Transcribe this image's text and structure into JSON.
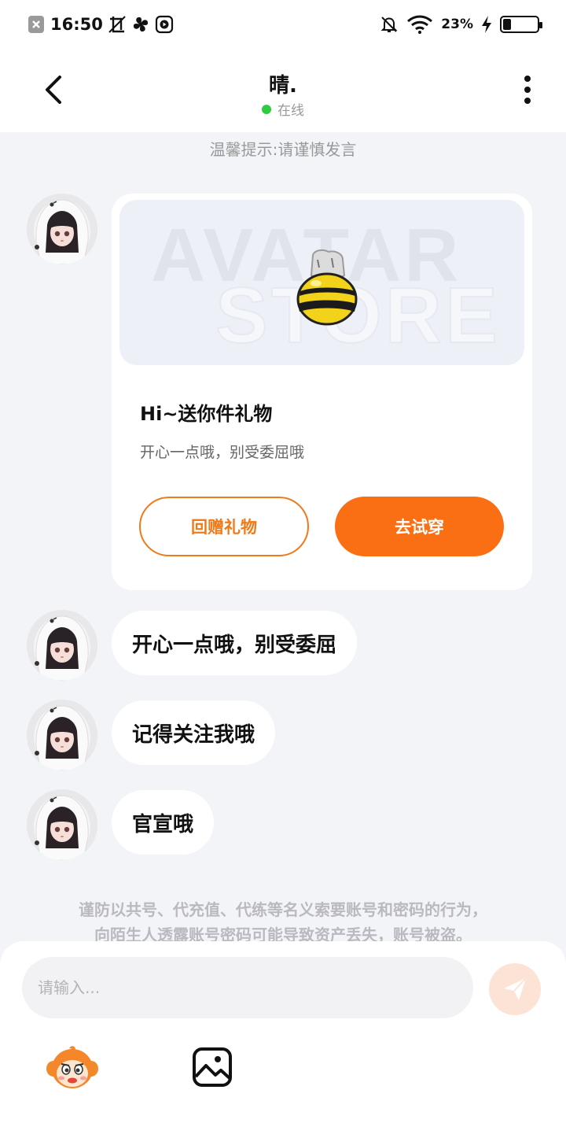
{
  "status_bar": {
    "time": "16:50",
    "battery_percent": "23%",
    "battery_level": 0.23,
    "icons": [
      "close-notification-icon",
      "screenshot-icon",
      "pinwheel-icon",
      "play-icon",
      "mute-bell-icon",
      "wifi-icon",
      "charging-icon",
      "battery-icon"
    ]
  },
  "header": {
    "title": "晴.",
    "status": "在线",
    "status_color": "#2ecc40"
  },
  "tip": "温馨提示:请谨慎发言",
  "gift_card": {
    "banner_text_1": "AVATAR",
    "banner_text_2": "STORE",
    "title": "Hi~送你件礼物",
    "subtitle": "开心一点哦，别受委屈哦",
    "return_button": "回赠礼物",
    "try_button": "去试穿"
  },
  "messages": [
    {
      "text": "开心一点哦，别受委屈"
    },
    {
      "text": "记得关注我哦"
    },
    {
      "text": "官宣哦"
    }
  ],
  "warning": {
    "line1": "谨防以共号、代充值、代练等名义索要账号和密码的行为，",
    "line2": "向陌生人透露账号密码可能导致资产丢失，账号被盗。"
  },
  "input": {
    "placeholder": "请输入..."
  },
  "colors": {
    "accent": "#fb6f14",
    "background": "#f3f4f8"
  }
}
